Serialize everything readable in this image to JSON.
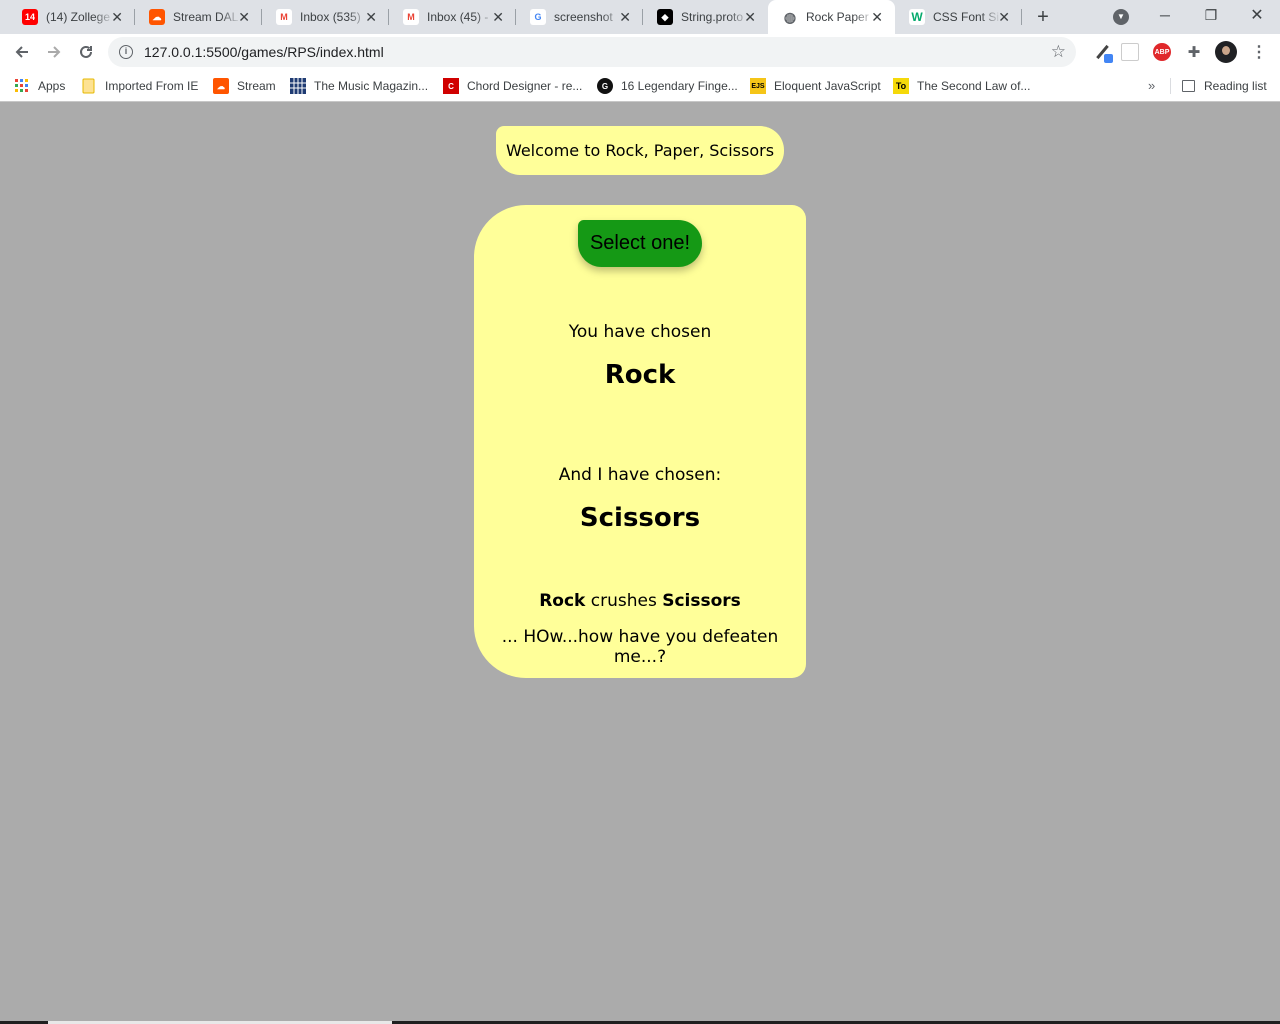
{
  "browser": {
    "tabs": [
      {
        "title": "(14) Zollege",
        "favicon": "youtube-notification-icon",
        "color": "#ff0000",
        "glyph": "14"
      },
      {
        "title": "Stream DAL",
        "favicon": "soundcloud-icon",
        "color": "#ff5500",
        "glyph": "☁"
      },
      {
        "title": "Inbox (535)",
        "favicon": "gmail-icon",
        "color": "#ea4335",
        "glyph": "M"
      },
      {
        "title": "Inbox (45) -",
        "favicon": "gmail-icon",
        "color": "#ea4335",
        "glyph": "M"
      },
      {
        "title": "screenshot",
        "favicon": "google-icon",
        "color": "#4285f4",
        "glyph": "G"
      },
      {
        "title": "String.proto",
        "favicon": "mdn-icon",
        "color": "#000000",
        "glyph": "◆"
      },
      {
        "title": "Rock Paper",
        "favicon": "globe-icon",
        "color": "#5f6368",
        "glyph": "◍"
      },
      {
        "title": "CSS Font Si",
        "favicon": "w3schools-icon",
        "color": "#04aa6d",
        "glyph": "W"
      }
    ],
    "active_tab": 6,
    "url": "127.0.0.1:5500/games/RPS/index.html",
    "bookmarks": [
      {
        "label": "Apps",
        "icon": "apps-grid-icon"
      },
      {
        "label": "Imported From IE",
        "icon": "folder-icon"
      },
      {
        "label": "Stream",
        "icon": "soundcloud-icon"
      },
      {
        "label": "The Music Magazin...",
        "icon": "music-magazine-icon"
      },
      {
        "label": "Chord Designer - re...",
        "icon": "chord-designer-icon"
      },
      {
        "label": "16 Legendary Finge...",
        "icon": "g-circle-icon"
      },
      {
        "label": "Eloquent JavaScript",
        "icon": "ejs-icon"
      },
      {
        "label": "The Second Law of...",
        "icon": "to-icon"
      }
    ],
    "more_bookmarks": "»",
    "reading_list": "Reading list"
  },
  "game": {
    "welcome": "Welcome to Rock, Paper, Scissors",
    "select_button": "Select one!",
    "player_label": "You have chosen",
    "player_choice": "Rock",
    "cpu_label": "And I have chosen:",
    "cpu_choice": "Scissors",
    "result_winner": "Rock",
    "result_verb": " crushes ",
    "result_loser": "Scissors",
    "taunt": "... HOw...how have you defeaten me...?"
  },
  "colors": {
    "page_bg": "#ababab",
    "card_bg": "#ffff99",
    "button_bg": "#159915"
  }
}
